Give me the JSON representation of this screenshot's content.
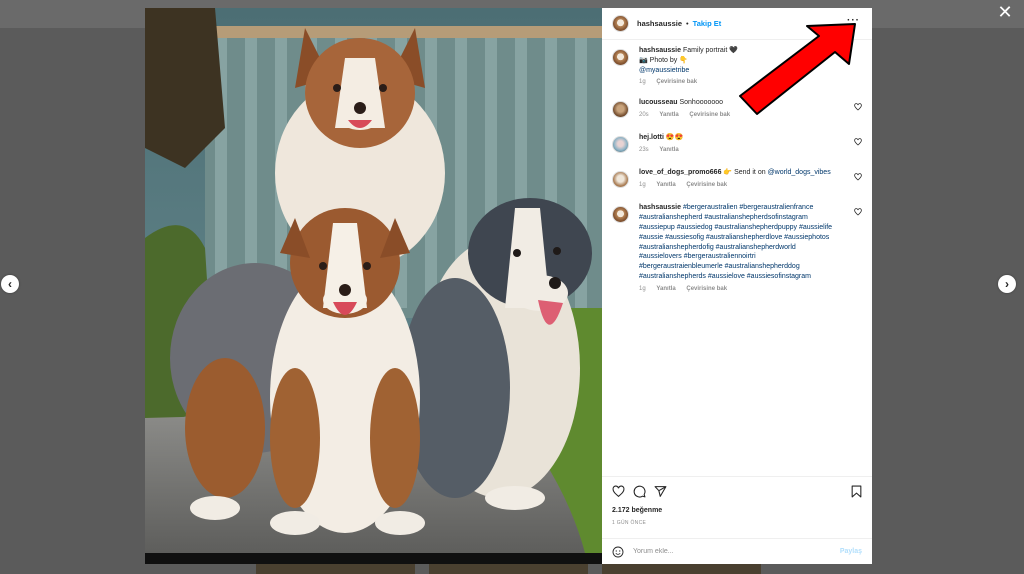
{
  "overlay": {
    "close_glyph": "✕",
    "prev_glyph": "‹",
    "next_glyph": "›"
  },
  "header": {
    "username": "hashsaussie",
    "separator": "•",
    "follow_label": "Takip Et",
    "more_glyph": "···"
  },
  "caption": {
    "username": "hashsaussie",
    "line1": "Family portrait 🖤",
    "line2": "📷 Photo by 👇",
    "mention": "@myaussietribe",
    "time": "1g",
    "translate": "Çevirisine bak"
  },
  "comments": [
    {
      "username": "lucousseau",
      "text": "Sonhooooooo",
      "time": "20s",
      "reply": "Yanıtla",
      "translate": "Çevirisine bak"
    },
    {
      "username": "hej.lotti",
      "text": "😍😍",
      "time": "23s",
      "reply": "Yanıtla"
    },
    {
      "username": "love_of_dogs_promo666",
      "text": "👉 Send it on ",
      "mention": "@world_dogs_vibes",
      "time": "1g",
      "reply": "Yanıtla",
      "translate": "Çevirisine bak"
    },
    {
      "username": "hashsaussie",
      "hashtags": "#bergeraustralien #bergeraustralienfrance #australianshepherd #australianshepherdsofinstagram #aussiepup #aussiedog #australianshepherdpuppy #aussielife #aussie #aussiesofig #australianshepherdlove #aussiephotos #australianshepherdofig #australianshepherdworld #aussielovers #bergeraustraliennoirtri #bergeraustraienbleumerle #australianshepherddog #australianshepherds #aussielove #aussiesofinstagram",
      "time": "1g",
      "reply": "Yanıtla",
      "translate": "Çevirisine bak"
    }
  ],
  "footer": {
    "likes": "2.172 beğenme",
    "date": "1 GÜN ÖNCE",
    "comment_placeholder": "Yorum ekle...",
    "post_label": "Paylaş"
  },
  "colors": {
    "link": "#0095f6",
    "annotation_arrow": "#ff0000"
  },
  "icons": [
    "close-icon",
    "chevron-left-icon",
    "chevron-right-icon",
    "more-options-icon",
    "heart-icon",
    "comment-icon",
    "share-icon",
    "bookmark-icon",
    "emoji-icon"
  ]
}
